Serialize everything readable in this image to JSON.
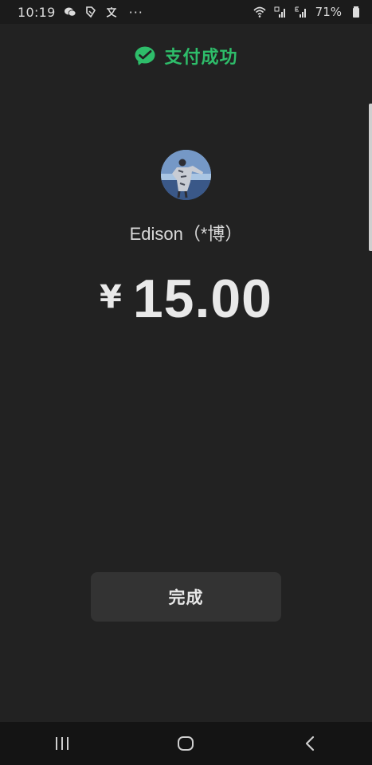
{
  "status_bar": {
    "time": "10:19",
    "dots": "···",
    "battery_pct": "71%",
    "icons": [
      "wechat-icon",
      "shield-icon",
      "translate-icon",
      "wifi-icon",
      "signal-4g-icon",
      "signal-e-icon",
      "battery-icon"
    ]
  },
  "header": {
    "title": "支付成功",
    "icon": "wechat-pay-check-icon"
  },
  "payee": {
    "name": "Edison（*博）"
  },
  "payment": {
    "currency_symbol": "¥",
    "amount": "15.00"
  },
  "actions": {
    "done_label": "完成"
  },
  "colors": {
    "background": "#222222",
    "accent": "#2ebd6a",
    "button_bg": "#333333",
    "text": "#e9e9e9"
  },
  "nav_bar": {
    "icons": [
      "recent-apps-icon",
      "home-icon",
      "back-icon"
    ]
  }
}
